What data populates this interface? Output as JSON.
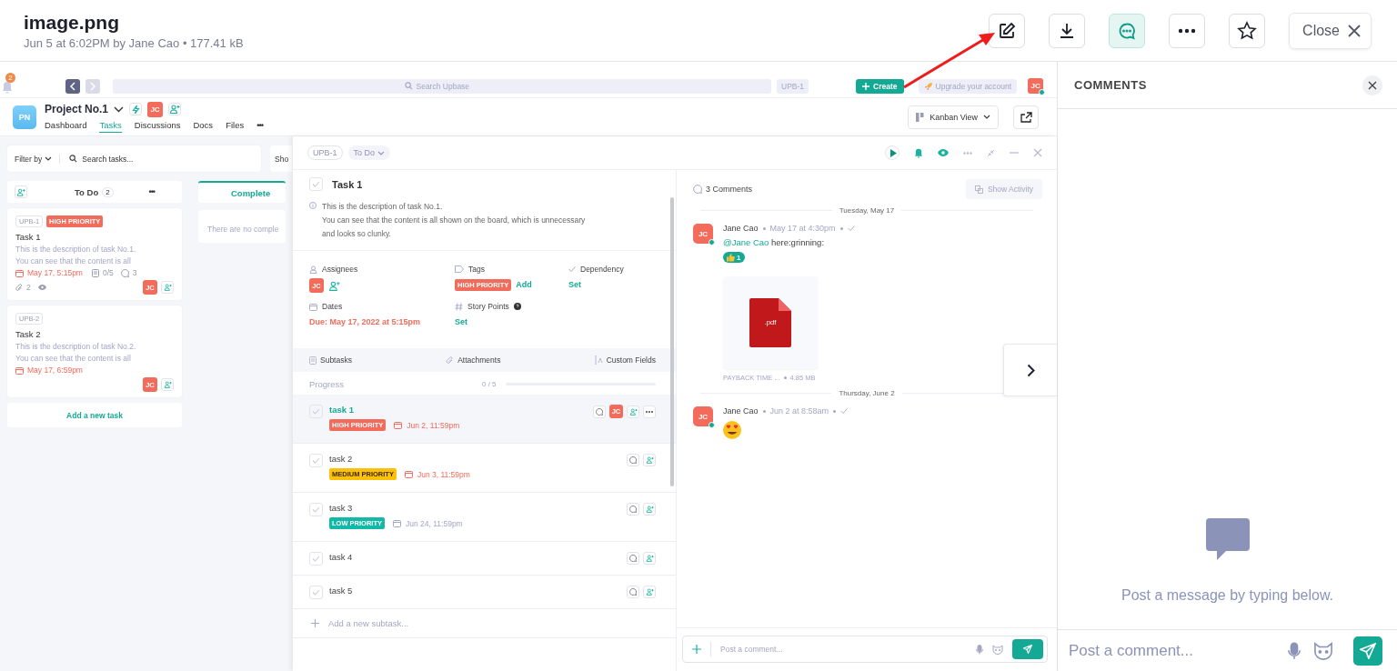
{
  "file": {
    "title": "image.png",
    "meta": "Jun 5 at 6:02PM by Jane Cao • 177.41 kB"
  },
  "toolbar": {
    "buttons": [
      {
        "kind": "edit",
        "selected": false
      },
      {
        "kind": "download",
        "selected": false
      },
      {
        "kind": "comments",
        "selected": true
      },
      {
        "kind": "more",
        "selected": false
      },
      {
        "kind": "star",
        "selected": false
      }
    ],
    "close": "Close"
  },
  "screenshot": {
    "app_bar": {
      "notifications": "2",
      "search_placeholder": "Search Upbase",
      "task_chip": "UPB-1",
      "create": "Create",
      "upgrade": "Upgrade your account",
      "avatar": "JC"
    },
    "project": {
      "logo": "PN",
      "name": "Project No.1",
      "avatar": "JC",
      "tabs": [
        {
          "label": "Dashboard",
          "selected": false
        },
        {
          "label": "Tasks",
          "selected": true
        },
        {
          "label": "Discussions",
          "selected": false
        },
        {
          "label": "Docs",
          "selected": false
        },
        {
          "label": "Files",
          "selected": false
        }
      ],
      "more": "•••",
      "view": "Kanban View"
    },
    "board": {
      "filter": "Filter by",
      "search_placeholder": "Search tasks...",
      "show": "Sho",
      "columns": [
        {
          "kind": "open",
          "title": "To Do",
          "count": "2",
          "more": "•••",
          "add": "Add a new task",
          "cards": [
            {
              "id": "UPB-1",
              "tags": [
                {
                  "label": "HIGH PRIORITY",
                  "color": "#f26b5b"
                }
              ],
              "title": "Task 1",
              "description": [
                "This is the description of task No.1.",
                "You can see that the content is all"
              ],
              "due": "May 17, 5:15pm",
              "subtasks": "0/5",
              "comments": "3",
              "attachments": "2",
              "watching": true,
              "avatar": "JC"
            },
            {
              "id": "UPB-2",
              "title": "Task 2",
              "description": [
                "This is the description of task No.2.",
                "You can see that the content is all"
              ],
              "due": "May 17, 6:59pm",
              "watching": false,
              "avatar": "JC"
            }
          ]
        },
        {
          "kind": "completed",
          "title": "Complete",
          "empty": "There are no comple"
        }
      ]
    },
    "task": {
      "id": "UPB-1",
      "status": "To Do",
      "title": "Task 1",
      "done": false,
      "description": [
        "This is the description of task No.1.",
        "You can see that the content is all shown on the board, which is unnecessary",
        "and looks so clunky."
      ],
      "fields": {
        "assignees": {
          "label": "Assignees",
          "avatar": "JC"
        },
        "tags": {
          "label": "Tags",
          "tag": {
            "label": "HIGH PRIORITY",
            "color": "#f26b5b"
          },
          "add": "Add"
        },
        "dependency": {
          "label": "Dependency",
          "value": "Set"
        },
        "dates": {
          "label": "Dates",
          "value": "Due: May 17, 2022 at 5:15pm"
        },
        "story_points": {
          "label": "Story Points",
          "value": "Set"
        }
      },
      "tabs": [
        {
          "kind": "subtasks",
          "label": "Subtasks"
        },
        {
          "kind": "attachments",
          "label": "Attachments"
        },
        {
          "kind": "custom",
          "label": "Custom Fields"
        }
      ],
      "progress": {
        "label": "Progress",
        "reading": "0 / 5",
        "level": 0
      },
      "subtasks": [
        {
          "title": "task 1",
          "selected": true,
          "done": false,
          "tag": {
            "label": "HIGH PRIORITY",
            "color": "#f26b5b"
          },
          "due": "Jun 2, 11:59pm",
          "overdue": true,
          "avatar": "JC"
        },
        {
          "title": "task 2",
          "selected": false,
          "done": false,
          "tag": {
            "label": "MEDIUM PRIORITY",
            "color": "#ffc107"
          },
          "due": "Jun 3, 11:59pm",
          "overdue": true
        },
        {
          "title": "task 3",
          "selected": false,
          "done": false,
          "tag": {
            "label": "LOW PRIORITY",
            "color": "#13b8a6"
          },
          "due": "Jun 24, 11:59pm",
          "overdue": false
        },
        {
          "title": "task 4",
          "selected": false,
          "done": false
        },
        {
          "title": "task 5",
          "selected": false,
          "done": false
        }
      ],
      "add_subtask": "Add a new subtask..."
    },
    "comments": {
      "count": "3 Comments",
      "show_activity": "Show Activity",
      "groups": [
        {
          "date": "Tuesday, May 17",
          "comments": [
            {
              "kind": "text",
              "avatar": "JC",
              "online": true,
              "author": "Jane Cao",
              "time": "May 17 at 4:30pm",
              "mention": "@Jane Cao",
              "text": "here:grinning:",
              "reaction_count": "1",
              "attachment": {
                "ext": ".pdf",
                "name": "PAYBACK TIME ...",
                "size": "4.85 MB"
              }
            }
          ]
        },
        {
          "date": "Thursday, June 2",
          "comments": [
            {
              "kind": "emoji",
              "avatar": "JC",
              "online": true,
              "author": "Jane Cao",
              "time": "Jun 2 at 8:58am"
            }
          ]
        }
      ],
      "input_placeholder": "Post a comment..."
    }
  },
  "comments_panel": {
    "title": "COMMENTS",
    "empty_message": "Post a message by typing below.",
    "input_placeholder": "Post a comment..."
  }
}
